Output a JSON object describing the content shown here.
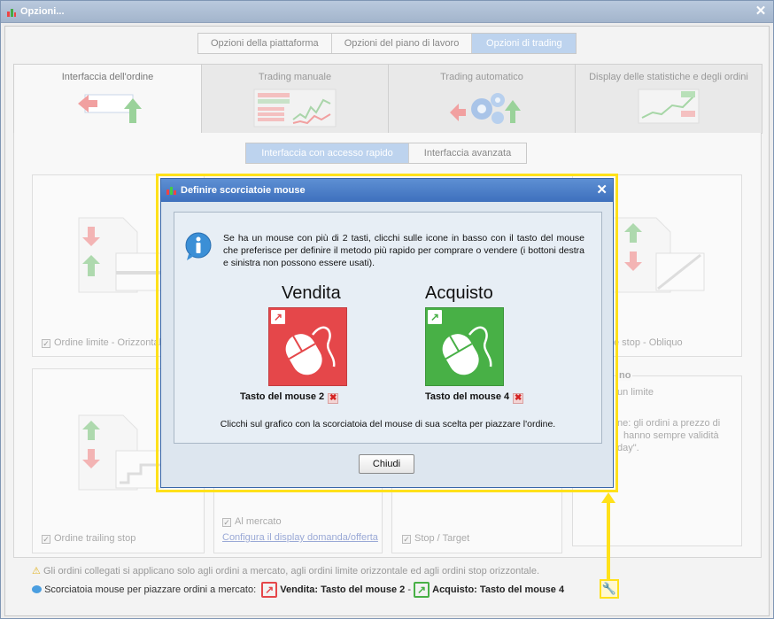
{
  "window": {
    "title": "Opzioni..."
  },
  "top_tabs": [
    {
      "label": "Opzioni della piattaforma",
      "active": false
    },
    {
      "label": "Opzioni del piano di lavoro",
      "active": false
    },
    {
      "label": "Opzioni di trading",
      "active": true
    }
  ],
  "category_tabs": [
    {
      "label": "Interfaccia dell'ordine",
      "active": true
    },
    {
      "label": "Trading manuale",
      "active": false
    },
    {
      "label": "Trading automatico",
      "active": false
    },
    {
      "label": "Display delle statistiche e degli ordini",
      "active": false
    }
  ],
  "sub_tabs": [
    {
      "label": "Interfaccia con accesso rapido",
      "active": true
    },
    {
      "label": "Interfaccia avanzata",
      "active": false
    }
  ],
  "cards": {
    "limit_horizontal": "Ordine limite - Orizzontale",
    "stop_oblique": "e stop - Obliquo",
    "trailing_stop": "Ordine trailing stop",
    "at_market": "Al mercato",
    "configure_link": "Configura il display domanda/offerta",
    "stop_target": "Stop / Target",
    "right_heading": "no",
    "right_limit": "un limite",
    "right_text_1": "ne: gli ordini a prezzo di",
    "right_text_2": "hanno sempre validità",
    "right_text_3": "day\"."
  },
  "footer": {
    "warning": "Gli ordini collegati si applicano solo agli ordini a mercato, agli ordini limite orizzontale ed agli ordini stop orizzontale.",
    "shortcut_label": "Scorciatoia mouse per piazzare ordini a mercato:",
    "sell_label": "Vendita:",
    "sell_key": "Tasto del mouse 2",
    "separator": "-",
    "buy_label": "Acquisto:",
    "buy_key": "Tasto del mouse 4"
  },
  "dialog": {
    "title": "Definire scorciatoie mouse",
    "message": "Se ha un mouse con più di 2 tasti, clicchi sulle icone in basso con il tasto del mouse che preferisce per definire il metodo più rapido per comprare o vendere (i bottoni destra e sinistra non possono essere usati).",
    "sell_title": "Vendita",
    "buy_title": "Acquisto",
    "sell_button": "Tasto del mouse 2",
    "buy_button": "Tasto del mouse 4",
    "hint": "Clicchi sul grafico con la scorciatoia del mouse di sua scelta per piazzare l'ordine.",
    "close": "Chiudi"
  },
  "colors": {
    "sell": "#e5474a",
    "buy": "#48b046",
    "highlight": "#ffe11a",
    "dialog_titlebar": "#4a7cc6"
  },
  "icons": {
    "info": "info-icon",
    "close": "close-icon",
    "wrench": "wrench-icon",
    "mouse": "mouse-icon",
    "warning": "warning-icon"
  }
}
